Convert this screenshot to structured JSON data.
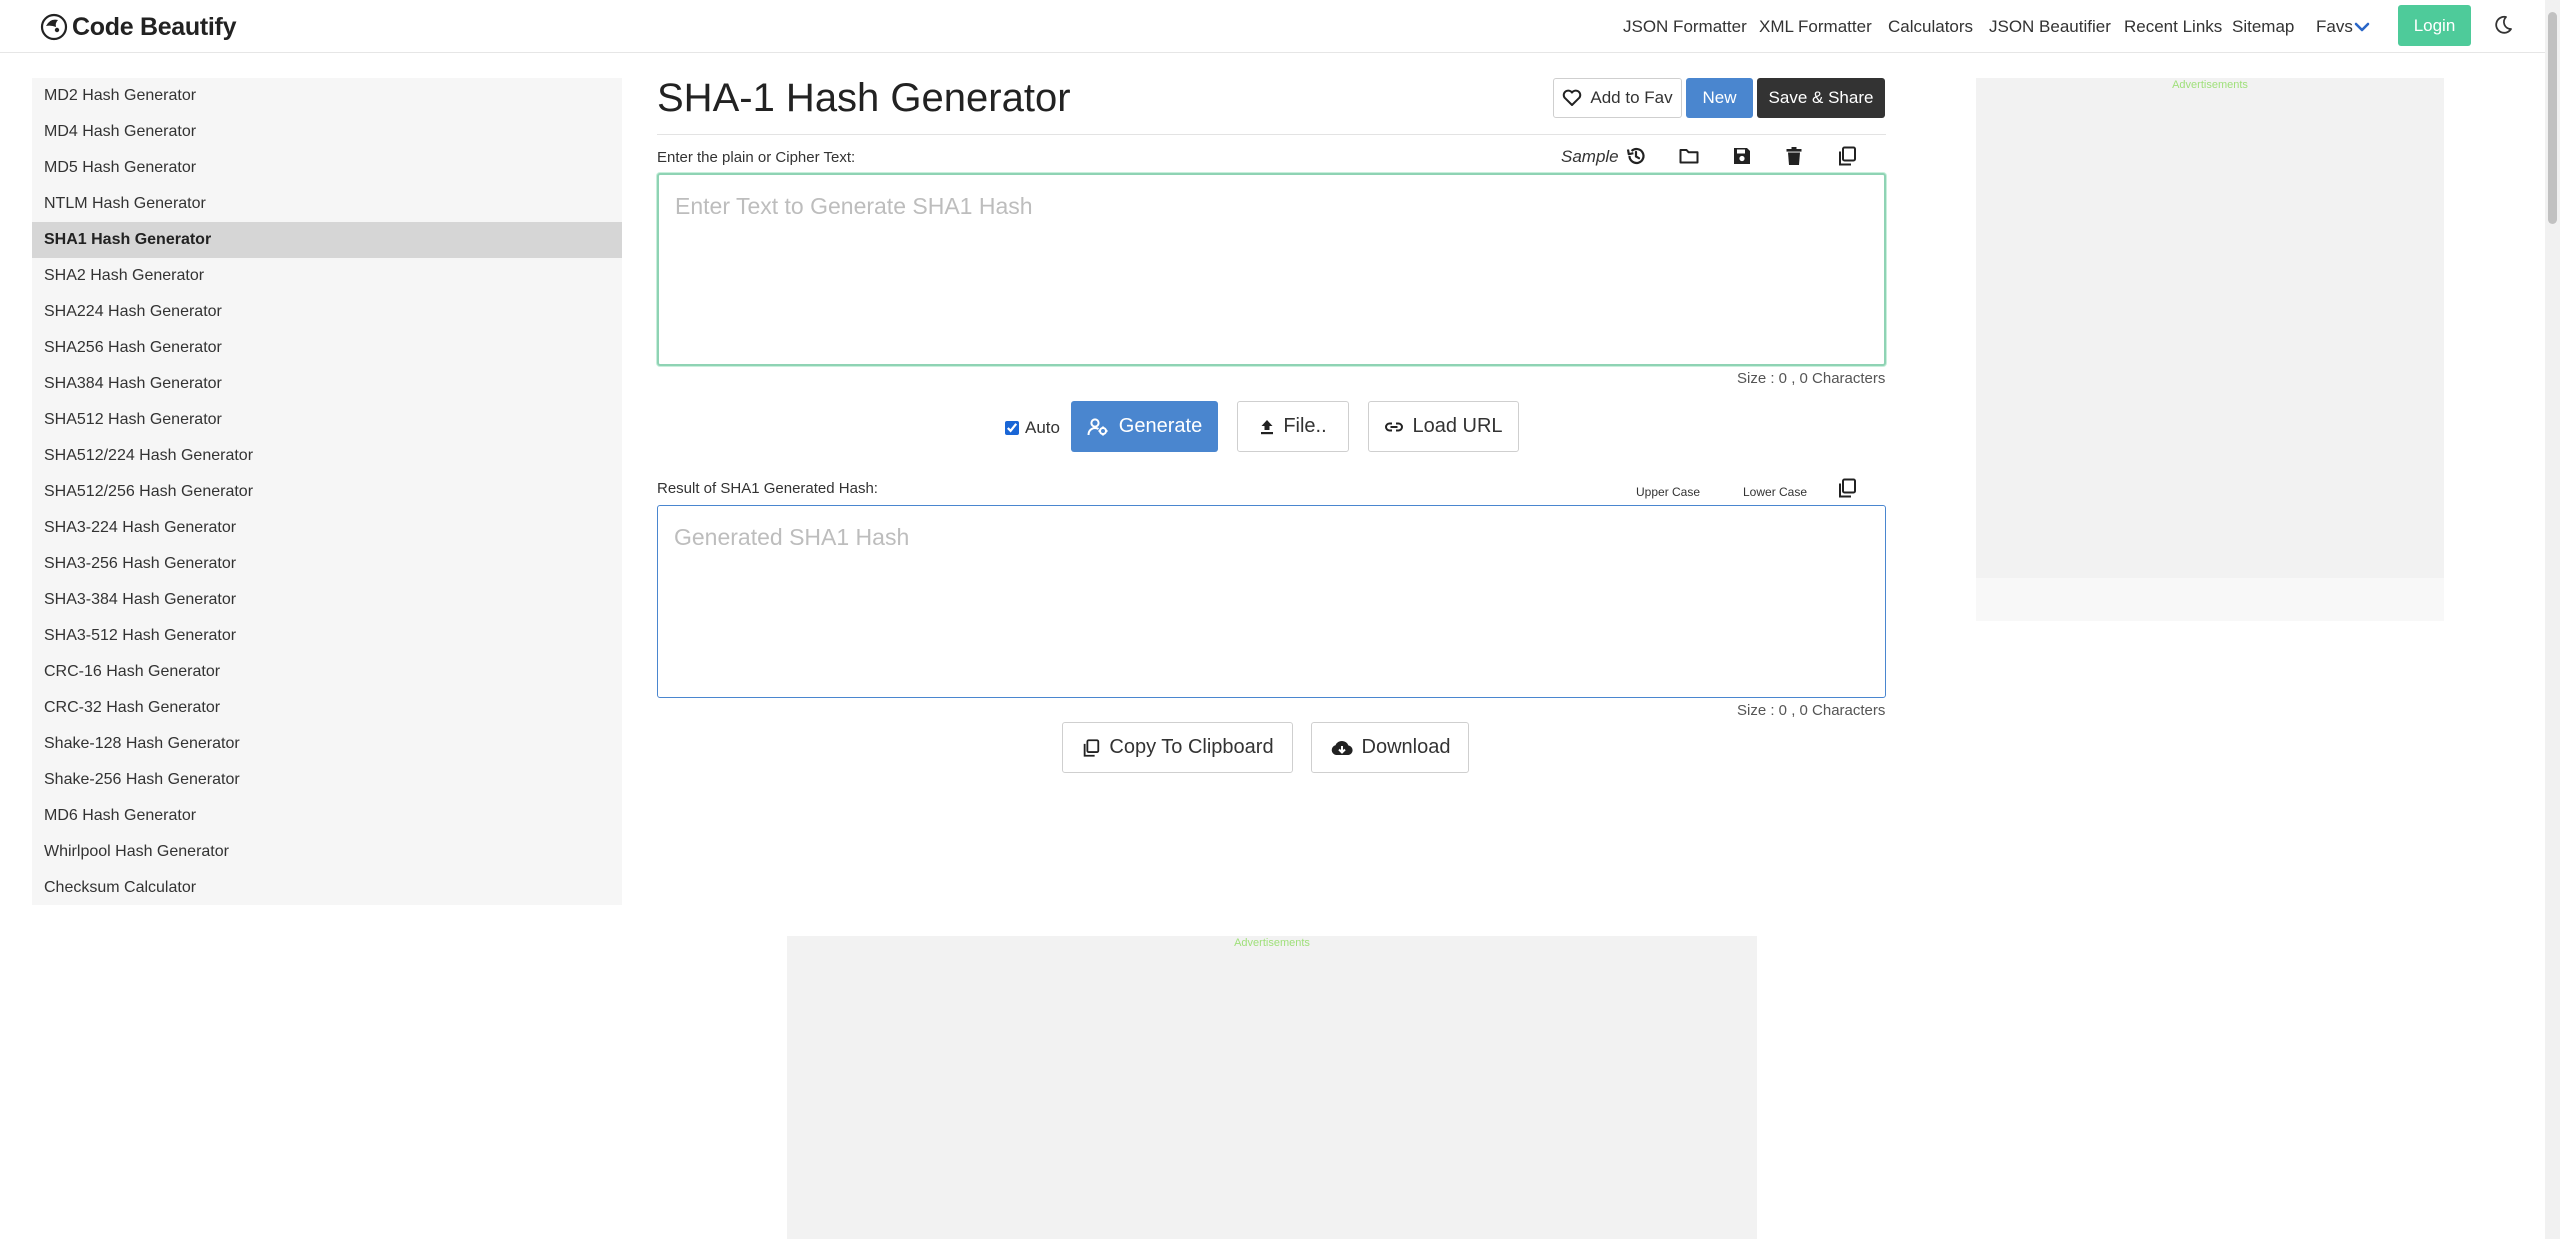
{
  "navbar": {
    "brand": "Code Beautify",
    "links": [
      {
        "label": "JSON Formatter"
      },
      {
        "label": "XML Formatter"
      },
      {
        "label": "Calculators"
      },
      {
        "label": "JSON Beautifier"
      },
      {
        "label": "Recent Links"
      },
      {
        "label": "Sitemap"
      },
      {
        "label": "Favs"
      }
    ],
    "login": "Login",
    "theme_icon": "moon-icon",
    "login_color": "#4ecb9a"
  },
  "sidebar": {
    "items": [
      {
        "label": "MD2 Hash Generator"
      },
      {
        "label": "MD4 Hash Generator"
      },
      {
        "label": "MD5 Hash Generator"
      },
      {
        "label": "NTLM Hash Generator"
      },
      {
        "label": "SHA1 Hash Generator",
        "active": true
      },
      {
        "label": "SHA2 Hash Generator"
      },
      {
        "label": "SHA224 Hash Generator"
      },
      {
        "label": "SHA256 Hash Generator"
      },
      {
        "label": "SHA384 Hash Generator"
      },
      {
        "label": "SHA512 Hash Generator"
      },
      {
        "label": "SHA512/224 Hash Generator"
      },
      {
        "label": "SHA512/256 Hash Generator"
      },
      {
        "label": "SHA3-224 Hash Generator"
      },
      {
        "label": "SHA3-256 Hash Generator"
      },
      {
        "label": "SHA3-384 Hash Generator"
      },
      {
        "label": "SHA3-512 Hash Generator"
      },
      {
        "label": "CRC-16 Hash Generator"
      },
      {
        "label": "CRC-32 Hash Generator"
      },
      {
        "label": "Shake-128 Hash Generator"
      },
      {
        "label": "Shake-256 Hash Generator"
      },
      {
        "label": "MD6 Hash Generator"
      },
      {
        "label": "Whirlpool Hash Generator"
      },
      {
        "label": "Checksum Calculator"
      }
    ]
  },
  "main": {
    "title": "SHA-1 Hash Generator",
    "add_to_fav": "Add to Fav",
    "new": "New",
    "save_share": "Save & Share",
    "input_label": "Enter the plain or Cipher Text:",
    "sample": "Sample",
    "input_placeholder": "Enter Text to Generate SHA1 Hash",
    "input_value": "",
    "input_size": "Size : 0 , 0 Characters",
    "auto_label": "Auto",
    "auto_checked": true,
    "generate": "Generate",
    "file": "File..",
    "load_url": "Load URL",
    "output_label": "Result of SHA1 Generated Hash:",
    "upper_case": "Upper Case",
    "lower_case": "Lower Case",
    "output_placeholder": "Generated SHA1 Hash",
    "output_value": "",
    "output_size": "Size : 0 , 0 Characters",
    "copy_clipboard": "Copy To Clipboard",
    "download": "Download"
  },
  "ads": {
    "right_label": "Advertisements",
    "bottom_label": "Advertisements"
  },
  "colors": {
    "primary": "#4a86cf",
    "dark": "#333333",
    "accent_green": "#4ecb9a"
  }
}
